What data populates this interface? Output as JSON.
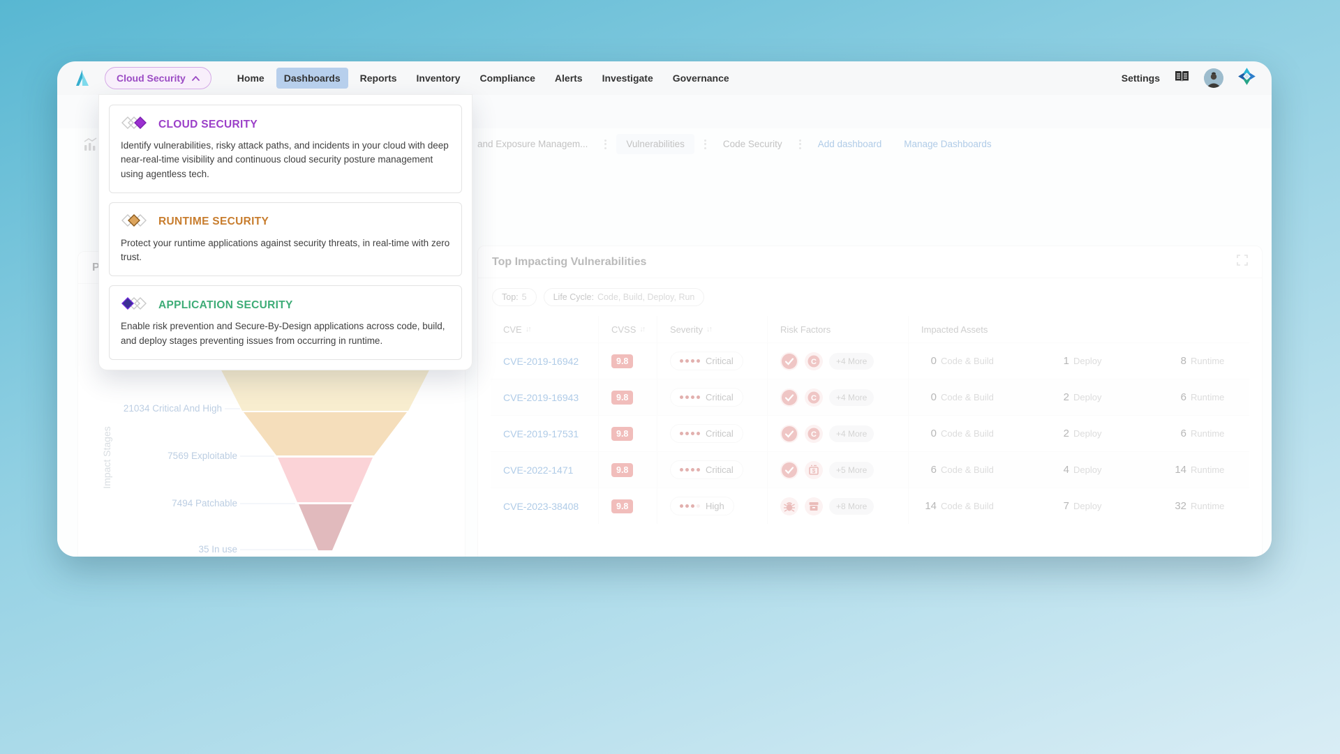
{
  "nav": {
    "switcher_label": "Cloud Security",
    "items": [
      "Home",
      "Dashboards",
      "Reports",
      "Inventory",
      "Compliance",
      "Alerts",
      "Investigate",
      "Governance"
    ],
    "active_item": "Dashboards",
    "settings_label": "Settings",
    "icons": [
      "brand-logo",
      "chevron-up-icon",
      "docs-book-icon",
      "user-avatar",
      "prisma-star-icon"
    ]
  },
  "product_menu": {
    "items": [
      {
        "title": "CLOUD SECURITY",
        "color": "#9b3fc8",
        "icon": "lifecycle-diamond-right",
        "description": "Identify vulnerabilities, risky attack paths, and incidents in your cloud with deep near-real-time visibility and continuous cloud security posture management using agentless tech."
      },
      {
        "title": "RUNTIME SECURITY",
        "color": "#c87d2e",
        "icon": "lifecycle-diamond-middle",
        "description": "Protect your runtime applications against security threats, in real-time with zero trust."
      },
      {
        "title": "APPLICATION SECURITY",
        "color": "#3eac77",
        "icon": "lifecycle-diamond-left",
        "description": "Enable risk prevention and Secure-By-Design applications across code, build, and deploy stages preventing issues from occurring in runtime."
      }
    ]
  },
  "tabbar": {
    "tabs": [
      {
        "label": "and Exposure Managem...",
        "state": "truncated"
      },
      {
        "label": "Vulnerabilities",
        "state": "selected"
      },
      {
        "label": "Code Security",
        "state": "normal"
      }
    ],
    "links": [
      "Add dashboard",
      "Manage Dashboards"
    ],
    "icons": [
      "dashboard-chart-icon",
      "kebab-menu-icon"
    ]
  },
  "left_panel": {
    "visible_title_text": "P"
  },
  "chart_data": {
    "type": "funnel",
    "title_visible_fragment": "P",
    "axis_label": "Impact Stages",
    "stages": [
      {
        "label": "Critical And High",
        "value": 21034,
        "color": "#edcf82"
      },
      {
        "label": "Exploitable",
        "value": 7569,
        "color": "#e4a94d"
      },
      {
        "label": "Patchable",
        "value": 7494,
        "color": "#f58d97"
      },
      {
        "label": "In use",
        "value": 35,
        "color": "#b04a52"
      }
    ],
    "label_color": "#4e7cb2",
    "legend_position": "left"
  },
  "right_panel": {
    "title": "Top Impacting Vulnerabilities",
    "filters": [
      {
        "label": "Top:",
        "value": "5"
      },
      {
        "label": "Life Cycle:",
        "value": "Code, Build, Deploy, Run"
      }
    ],
    "table": {
      "columns": [
        "CVE",
        "CVSS",
        "Severity",
        "Risk Factors",
        "Impacted Assets"
      ],
      "sortable_columns": [
        "CVE",
        "CVSS",
        "Severity"
      ],
      "asset_labels": {
        "code_build": "Code & Build",
        "deploy": "Deploy",
        "runtime": "Runtime"
      },
      "rows": [
        {
          "cve": "CVE-2019-16942",
          "cvss": "9.8",
          "severity": "Critical",
          "dots": 4,
          "risk_icons": [
            "check-circle-icon",
            "c-badge-icon"
          ],
          "more": "+4 More",
          "code_build": "0",
          "deploy": "1",
          "runtime": "8"
        },
        {
          "cve": "CVE-2019-16943",
          "cvss": "9.8",
          "severity": "Critical",
          "dots": 4,
          "risk_icons": [
            "check-circle-icon",
            "c-badge-icon"
          ],
          "more": "+4 More",
          "code_build": "0",
          "deploy": "2",
          "runtime": "6"
        },
        {
          "cve": "CVE-2019-17531",
          "cvss": "9.8",
          "severity": "Critical",
          "dots": 4,
          "risk_icons": [
            "check-circle-icon",
            "c-badge-icon"
          ],
          "more": "+4 More",
          "code_build": "0",
          "deploy": "2",
          "runtime": "6"
        },
        {
          "cve": "CVE-2022-1471",
          "cvss": "9.8",
          "severity": "Critical",
          "dots": 4,
          "risk_icons": [
            "check-circle-icon",
            "shell-box-icon"
          ],
          "more": "+5 More",
          "code_build": "6",
          "deploy": "4",
          "runtime": "14"
        },
        {
          "cve": "CVE-2023-38408",
          "cvss": "9.8",
          "severity": "High",
          "dots": 3,
          "risk_icons": [
            "bug-icon",
            "archive-box-icon"
          ],
          "more": "+8 More",
          "code_build": "14",
          "deploy": "7",
          "runtime": "32"
        }
      ]
    }
  }
}
